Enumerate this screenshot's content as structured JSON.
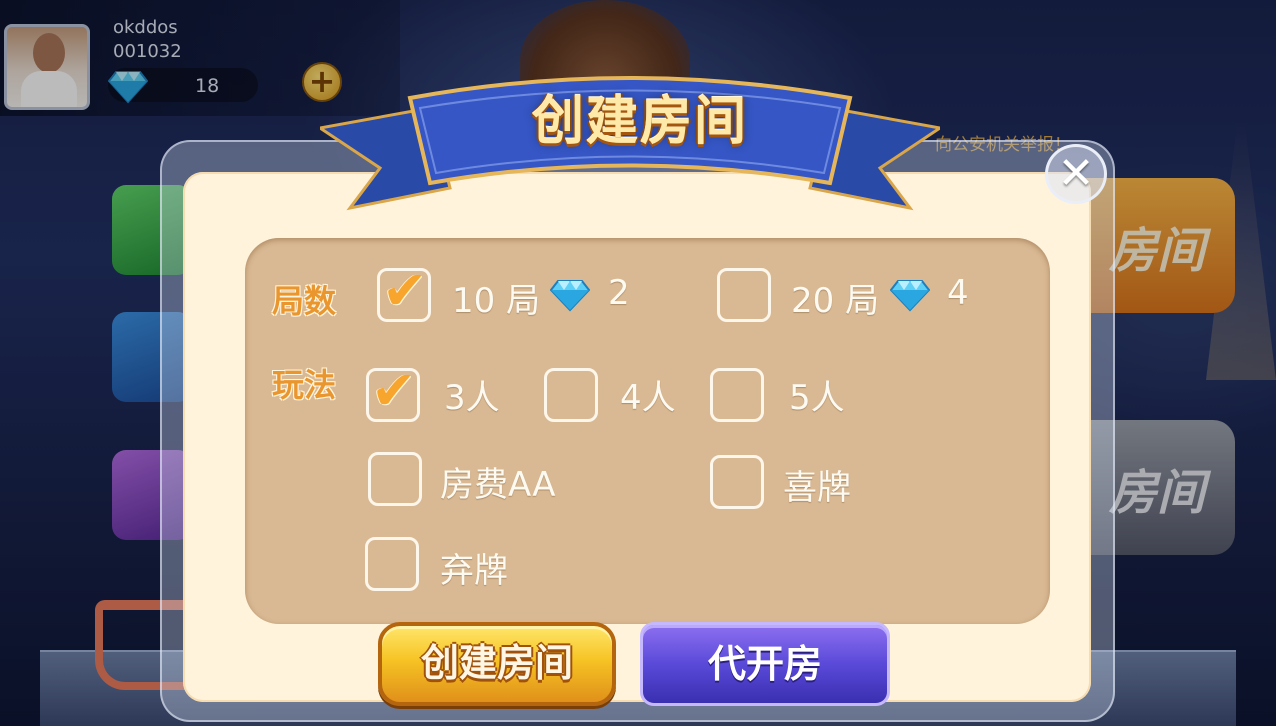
{
  "user": {
    "name": "okddos",
    "id": "001032",
    "diamonds": "18",
    "add_label": "+"
  },
  "notice": "向公安机关举报！",
  "background": {
    "room_button_1": "房间",
    "room_button_2": "房间"
  },
  "dialog": {
    "title": "创建房间",
    "close_label": "✕",
    "rounds": {
      "label": "局数",
      "options": [
        {
          "label": "10 局",
          "cost": "2",
          "checked": true
        },
        {
          "label": "20 局",
          "cost": "4",
          "checked": false
        }
      ]
    },
    "gameplay": {
      "label": "玩法",
      "players": [
        {
          "label": "3人",
          "checked": true
        },
        {
          "label": "4人",
          "checked": false
        },
        {
          "label": "5人",
          "checked": false
        }
      ],
      "extras": [
        {
          "label": "房费AA",
          "checked": false
        },
        {
          "label": "喜牌",
          "checked": false
        },
        {
          "label": "弃牌",
          "checked": false
        }
      ]
    },
    "create_button": "创建房间",
    "proxy_button": "代开房"
  },
  "colors": {
    "accent_gold": "#f6c324",
    "checkmark": "#f7a52c",
    "panel": "#d9b993",
    "dialog_bg": "#fff3dc",
    "proxy_purple": "#5a4ad9"
  },
  "icons": {
    "currency": "diamond-icon",
    "check": "checkmark-icon",
    "close": "close-icon"
  }
}
